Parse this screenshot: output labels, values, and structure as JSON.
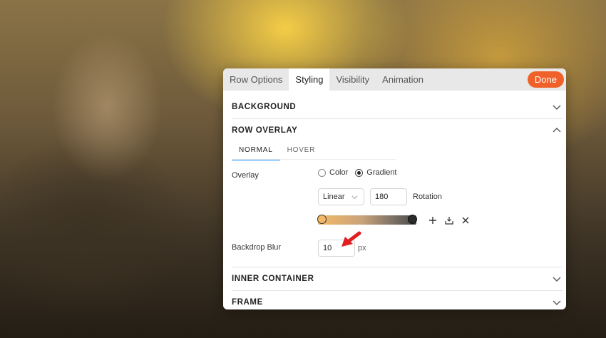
{
  "tabs": [
    {
      "label": "Row Options"
    },
    {
      "label": "Styling"
    },
    {
      "label": "Visibility"
    },
    {
      "label": "Animation"
    }
  ],
  "done_label": "Done",
  "sections": {
    "background": "BACKGROUND",
    "row_overlay": "ROW OVERLAY",
    "inner_container": "INNER CONTAINER",
    "frame": "FRAME"
  },
  "overlay": {
    "subtabs": [
      "NORMAL",
      "HOVER"
    ],
    "overlay_label": "Overlay",
    "radio_color": "Color",
    "radio_gradient": "Gradient",
    "selected": "Gradient",
    "gradient_type": "Linear",
    "angle": "180",
    "rotation_label": "Rotation",
    "backdrop_blur_label": "Backdrop Blur",
    "backdrop_blur_value": "10",
    "unit": "px"
  },
  "colors": {
    "accent": "#f0612a",
    "subtab_active": "#1e90ff",
    "annotation_arrow": "#e02020"
  }
}
